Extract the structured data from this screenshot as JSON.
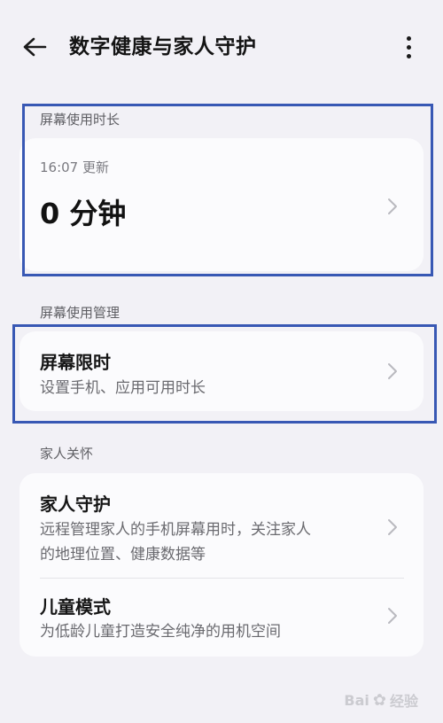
{
  "header": {
    "title": "数字健康与家人守护",
    "back_icon": "arrow-left-icon",
    "more_icon": "more-vertical-icon"
  },
  "screen_time": {
    "section_label": "屏幕使用时长",
    "updated": "16:07 更新",
    "value": "0 分钟"
  },
  "screen_management": {
    "section_label": "屏幕使用管理",
    "limit_title": "屏幕限时",
    "limit_subtitle": "设置手机、应用可用时长"
  },
  "family_care": {
    "section_label": "家人关怀",
    "guard_title": "家人守护",
    "guard_subtitle_line1": "远程管理家人的手机屏幕用时，关注家人",
    "guard_subtitle_line2": "的地理位置、健康数据等",
    "kids_title": "儿童模式",
    "kids_subtitle": "为低龄儿童打造安全纯净的用机空间"
  },
  "watermark": {
    "text": "Bai",
    "text2": "经验"
  },
  "colors": {
    "highlight_border": "#3858b4",
    "background": "#f2f1f6",
    "card": "#fbfbfd"
  }
}
